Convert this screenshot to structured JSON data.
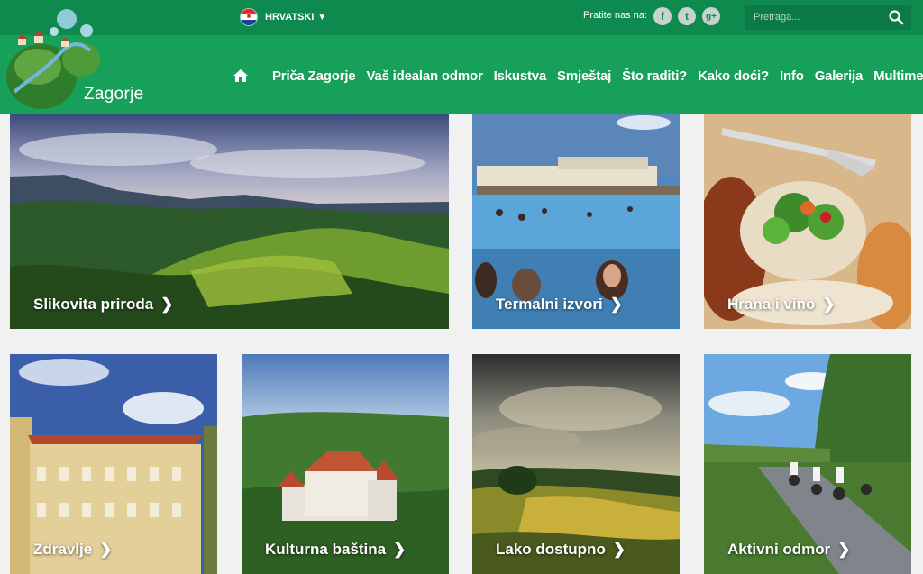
{
  "header": {
    "language": "HRVATSKI",
    "follow_label": "Pratite nas na:",
    "social": [
      {
        "name": "facebook-icon",
        "glyph": "f"
      },
      {
        "name": "twitter-icon",
        "glyph": "t"
      },
      {
        "name": "google-plus-icon",
        "glyph": "g+"
      }
    ],
    "search_placeholder": "Pretraga..."
  },
  "logo": {
    "text": "Zagorje"
  },
  "nav": {
    "items": [
      "Priča Zagorje",
      "Vaš idealan odmor",
      "Iskustva",
      "Smještaj",
      "Što raditi?",
      "Kako doći?",
      "Info",
      "Galerija",
      "Multimedija"
    ]
  },
  "tiles": [
    {
      "label": "Slikovita priroda"
    },
    {
      "label": "Termalni izvori"
    },
    {
      "label": "Hrana i vino"
    },
    {
      "label": "Zdravlje"
    },
    {
      "label": "Kulturna baština"
    },
    {
      "label": "Lako dostupno"
    },
    {
      "label": "Aktivni odmor"
    }
  ],
  "colors": {
    "topbar": "#0e8a4f",
    "navbar": "#16a05a",
    "background": "#f1f1f1"
  }
}
